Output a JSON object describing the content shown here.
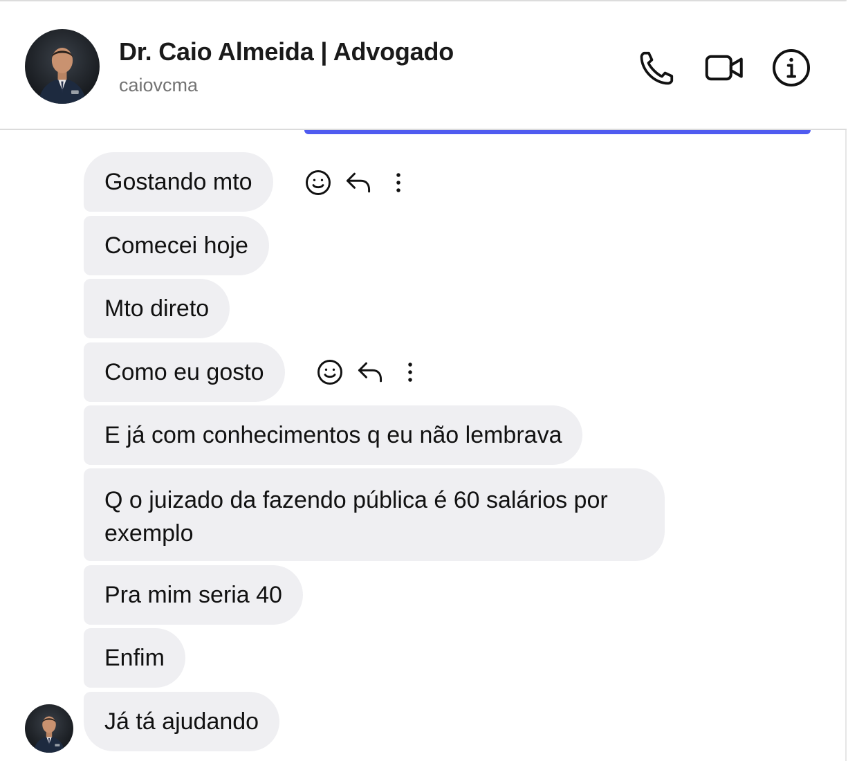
{
  "header": {
    "name": "Dr. Caio Almeida | Advogado",
    "username": "caiovcma",
    "icons": [
      "phone-icon",
      "video-camera-icon",
      "info-icon"
    ]
  },
  "messages": [
    {
      "text": "Gostando mto",
      "has_actions": true
    },
    {
      "text": "Comecei hoje"
    },
    {
      "text": "Mto direto"
    },
    {
      "text": "Como eu gosto",
      "has_actions": true
    },
    {
      "text": "E já com conhecimentos q eu não lembrava"
    },
    {
      "text": "Q o juizado da fazendo pública é 60 salários por exemplo"
    },
    {
      "text": "Pra mim seria 40"
    },
    {
      "text": "Enfim"
    },
    {
      "text": "Já tá ajudando"
    }
  ],
  "message_actions": [
    "smiley-react-icon",
    "reply-arrow-icon",
    "more-options-icon"
  ],
  "colors": {
    "bubble": "#efeff2",
    "accent_bar": "#4f5bf0",
    "username": "#737373"
  }
}
